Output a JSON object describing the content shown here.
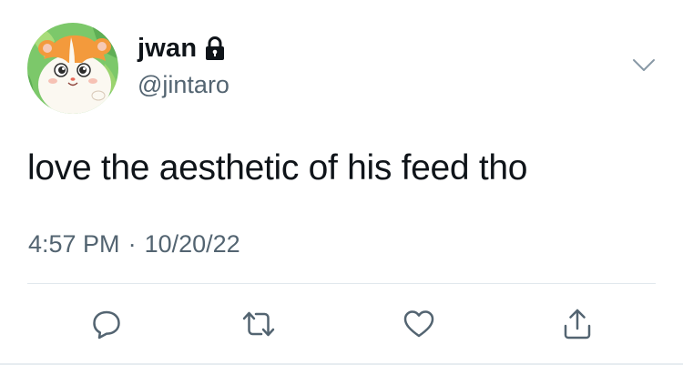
{
  "user": {
    "display_name": "jwan",
    "handle": "@jintaro",
    "protected_icon": "lock-icon",
    "avatar": "hamster-cartoon-avatar"
  },
  "tweet": {
    "text": "love the aesthetic of his feed tho",
    "time": "4:57 PM",
    "separator": "·",
    "date": "10/20/22"
  },
  "actions": [
    {
      "name": "reply",
      "icon": "speech-bubble-icon"
    },
    {
      "name": "retweet",
      "icon": "retweet-icon"
    },
    {
      "name": "like",
      "icon": "heart-icon"
    },
    {
      "name": "share",
      "icon": "share-icon"
    }
  ],
  "colors": {
    "text_primary": "#0f1419",
    "text_secondary": "#536471",
    "icon_gray": "#536471",
    "divider": "#e1e8ed"
  }
}
